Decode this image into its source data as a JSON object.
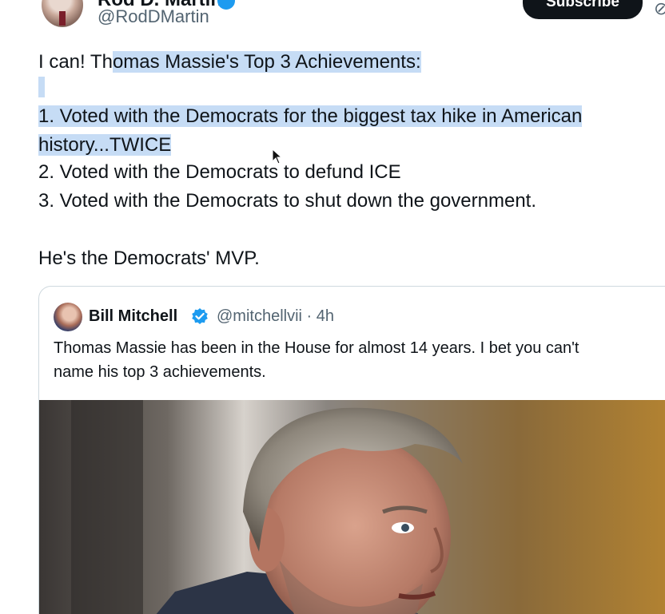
{
  "header": {
    "display_name": "Rod D. Martin",
    "handle": "@RodDMartin",
    "subscribe_label": "Subscribe"
  },
  "tweet": {
    "line1_prefix": "I can! Th",
    "line1_selected": "omas Massie's Top 3 Achievements:",
    "item1_line1": "1. Voted with the Democrats for the biggest tax hike in American",
    "item1_line2": "history...TWICE",
    "item2": "2. Voted with the Democrats to defund ICE",
    "item3": "3. Voted with the Democrats to shut down the government.",
    "closing": "He's the Democrats' MVP."
  },
  "quoted_tweet": {
    "name": "Bill Mitchell",
    "handle_time": "@mitchellvii · 4h",
    "text_line1": "Thomas Massie has been in the House for almost 14 years.  I bet you can't",
    "text_line2": "name his top 3 achievements."
  },
  "icons": {
    "verified": "verified-badge-icon",
    "cursor": "mouse-pointer-icon"
  },
  "colors": {
    "selection": "#c6dcf5",
    "verified": "#1d9bf0",
    "handle": "#536471",
    "text": "#0f1419",
    "button": "#0f1419"
  }
}
